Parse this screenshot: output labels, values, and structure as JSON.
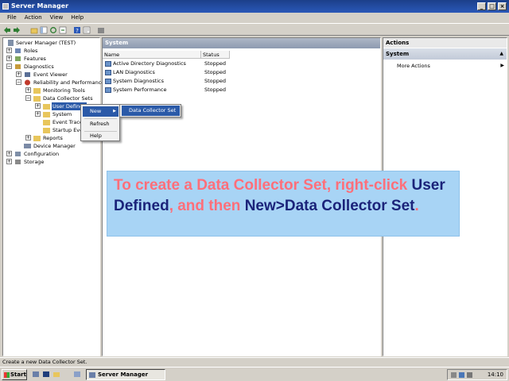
{
  "window": {
    "title": "Server Manager"
  },
  "menu": [
    "File",
    "Action",
    "View",
    "Help"
  ],
  "tree": {
    "nodes": [
      {
        "label": "Server Manager (TEST)",
        "expander": ""
      },
      {
        "label": "Roles",
        "expander": "+"
      },
      {
        "label": "Features",
        "expander": "+"
      },
      {
        "label": "Diagnostics",
        "expander": "−"
      },
      {
        "label": "Event Viewer",
        "expander": "+"
      },
      {
        "label": "Reliability and Performance",
        "expander": "−"
      },
      {
        "label": "Monitoring Tools",
        "expander": "+"
      },
      {
        "label": "Data Collector Sets",
        "expander": "−"
      },
      {
        "label": "User Defined",
        "expander": "+"
      },
      {
        "label": "System",
        "expander": "+"
      },
      {
        "label": "Event Trace",
        "expander": ""
      },
      {
        "label": "Startup Eve",
        "expander": ""
      },
      {
        "label": "Reports",
        "expander": "+"
      },
      {
        "label": "Device Manager",
        "expander": ""
      },
      {
        "label": "Configuration",
        "expander": "+"
      },
      {
        "label": "Storage",
        "expander": "+"
      }
    ]
  },
  "middle": {
    "header": "System",
    "columns": [
      "Name",
      "Status"
    ],
    "rows": [
      {
        "name": "Active Directory Diagnostics",
        "status": "Stopped"
      },
      {
        "name": "LAN Diagnostics",
        "status": "Stopped"
      },
      {
        "name": "System Diagnostics",
        "status": "Stopped"
      },
      {
        "name": "System Performance",
        "status": "Stopped"
      }
    ]
  },
  "actions": {
    "header": "Actions",
    "section": "System",
    "item": "More Actions"
  },
  "context_menu": {
    "items": [
      "New",
      "Refresh",
      "Help"
    ],
    "submenu": "Data Collector Set"
  },
  "callout": {
    "p1": "To create a Data Collector Set, right-click ",
    "b1": "User Defined",
    "p2": ", and then ",
    "b2": "New>Data Collector Set",
    "p3": "."
  },
  "statusbar": "Create a new Data Collector Set.",
  "taskbar": {
    "start": "Start",
    "task": "Server Manager",
    "time": "14:10"
  },
  "colors": {
    "title_bar": "#2a58b8",
    "callout_bg": "#a8d4f5",
    "pink": "#ff6f7a",
    "navy": "#1b237a",
    "selection": "#2b5aa8"
  }
}
